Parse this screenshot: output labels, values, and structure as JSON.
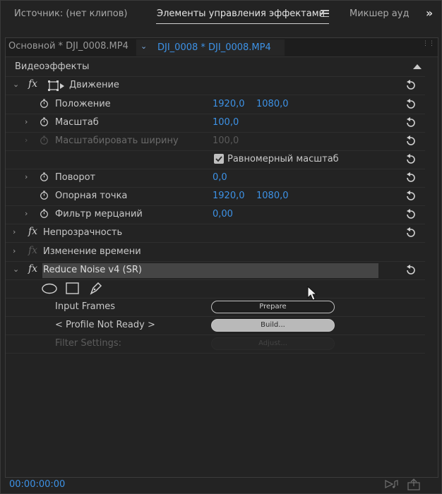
{
  "tabs": {
    "source": "Источник: (нет клипов)",
    "effect_controls": "Элементы управления эффектами",
    "audio_mixer": "Микшер ауд"
  },
  "subbar": {
    "source_clip": "Основной * DJI_0008.MP4",
    "sequence_clip": "DJI_0008 * DJI_0008.MP4"
  },
  "section_header": "Видеоэффекты",
  "motion": {
    "name": "Движение",
    "position": {
      "label": "Положение",
      "x": "1920,0",
      "y": "1080,0"
    },
    "scale": {
      "label": "Масштаб",
      "value": "100,0"
    },
    "scale_width": {
      "label": "Масштабировать ширину",
      "value": "100,0"
    },
    "uniform_scale": {
      "label": "Равномерный масштаб",
      "checked": true
    },
    "rotation": {
      "label": "Поворот",
      "value": "0,0"
    },
    "anchor": {
      "label": "Опорная точка",
      "x": "1920,0",
      "y": "1080,0"
    },
    "flicker": {
      "label": "Фильтр мерцаний",
      "value": "0,00"
    }
  },
  "opacity": {
    "name": "Непрозрачность"
  },
  "time_remap": {
    "name": "Изменение времени"
  },
  "reduce_noise": {
    "name": "Reduce Noise v4 (SR)",
    "input_frames": {
      "label": "Input Frames",
      "button": "Prepare"
    },
    "profile": {
      "label": "< Profile Not Ready >",
      "button": "Build..."
    },
    "filter_settings": {
      "label": "Filter Settings:",
      "button": "Adjust..."
    }
  },
  "footer": {
    "timecode": "00:00:00:00"
  },
  "colors": {
    "accent_blue": "#3d92e6",
    "panel_bg": "#232323"
  }
}
